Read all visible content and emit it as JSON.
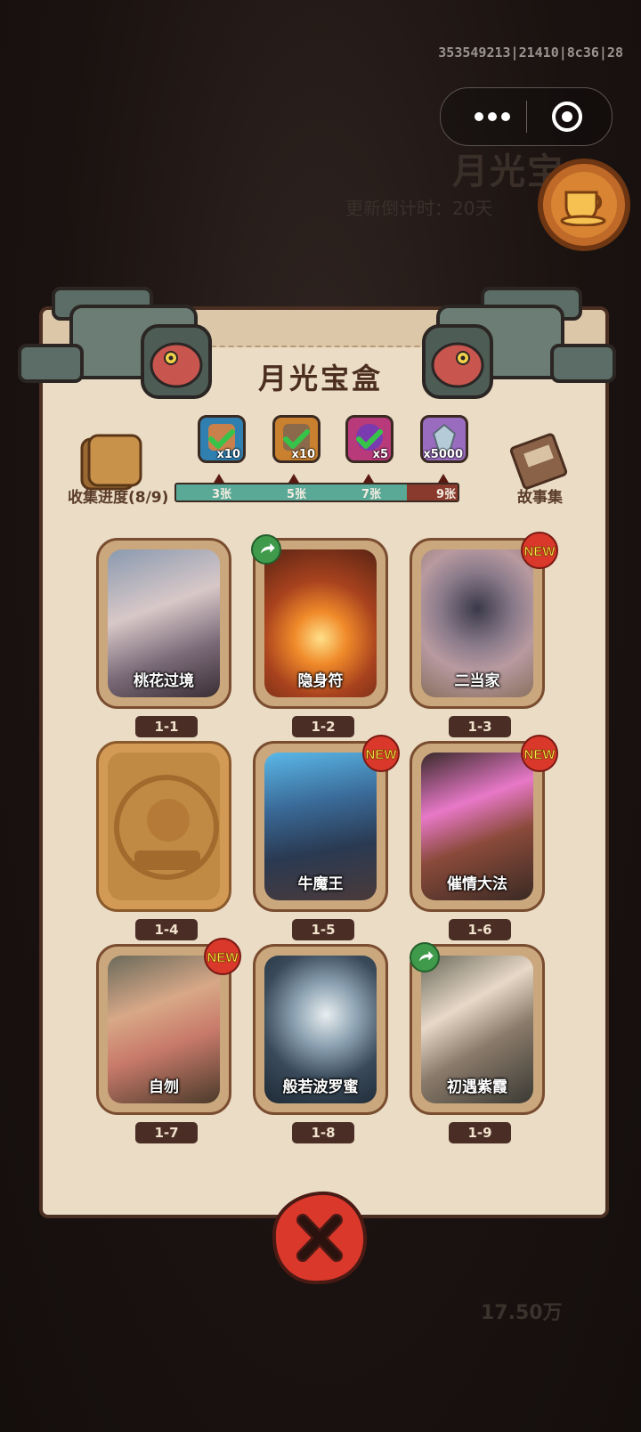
{
  "build_info": "353549213|21410|8c36|28",
  "background": {
    "title": "月光宝",
    "subtitle": "更新倒计时：20天",
    "amount": "17.50万"
  },
  "miniprogram": {
    "more_icon": "more-dots-icon",
    "close_icon": "target-close-icon"
  },
  "panel": {
    "title": "月光宝盒",
    "collect_label": "收集进度(8/9)",
    "story_label": "故事集"
  },
  "rewards": [
    {
      "icon": "scroll-check-icon",
      "count": "x10",
      "color": "#2f7fb0"
    },
    {
      "icon": "ticket-check-icon",
      "count": "x10",
      "color": "#c9802f"
    },
    {
      "icon": "orb-check-icon",
      "count": "x5",
      "color": "#b93a7a"
    },
    {
      "icon": "crystal-icon",
      "count": "x5000",
      "color": "#9a6cc0"
    }
  ],
  "progress": {
    "ticks": [
      "3张",
      "5张",
      "7张",
      "9张"
    ],
    "fraction": 0.82
  },
  "cards": [
    {
      "id": "1-1",
      "name": "桃花过境",
      "status": "none"
    },
    {
      "id": "1-2",
      "name": "隐身符",
      "status": "share"
    },
    {
      "id": "1-3",
      "name": "二当家",
      "status": "new"
    },
    {
      "id": "1-4",
      "name": "",
      "status": "locked"
    },
    {
      "id": "1-5",
      "name": "牛魔王",
      "status": "new"
    },
    {
      "id": "1-6",
      "name": "催情大法",
      "status": "new"
    },
    {
      "id": "1-7",
      "name": "自刎",
      "status": "new"
    },
    {
      "id": "1-8",
      "name": "般若波罗蜜",
      "status": "none"
    },
    {
      "id": "1-9",
      "name": "初遇紫霞",
      "status": "share"
    }
  ],
  "new_label": "NEW",
  "colors": {
    "panel": "#ebdcc5",
    "frame": "#4b2f22",
    "close_red": "#d9382b",
    "share_green": "#3f9a4b"
  }
}
